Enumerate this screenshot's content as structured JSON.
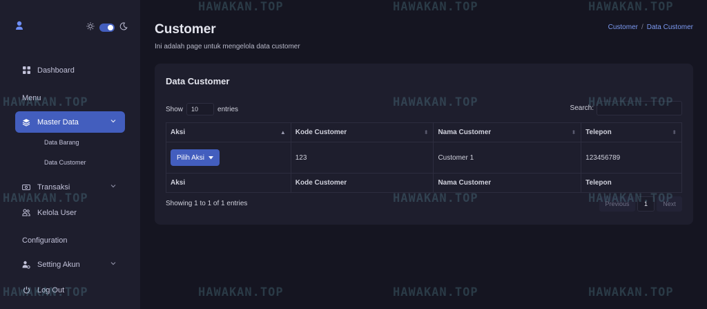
{
  "sidebar": {
    "items": [
      {
        "label": "Dashboard",
        "icon": "grid-icon"
      },
      {
        "label": "Master Data",
        "icon": "layers-icon",
        "active": true
      },
      {
        "label": "Transaksi",
        "icon": "cash-icon"
      },
      {
        "label": "Kelola User",
        "icon": "users-icon"
      },
      {
        "label": "Setting Akun",
        "icon": "user-gear-icon"
      },
      {
        "label": "Log Out",
        "icon": "power-icon"
      }
    ],
    "sections": {
      "menu": "Menu",
      "configuration": "Configuration"
    },
    "subitems": [
      "Data Barang",
      "Data Customer"
    ]
  },
  "page": {
    "title": "Customer",
    "subtitle": "Ini adalah page untuk mengelola data customer",
    "breadcrumb": [
      "Customer",
      "/",
      "Data Customer"
    ]
  },
  "card": {
    "title": "Data Customer",
    "show_label": "Show",
    "entries_value": "10",
    "entries_label": "entries",
    "search_label": "Search:",
    "columns": [
      "Aksi",
      "Kode Customer",
      "Nama Customer",
      "Telepon"
    ],
    "rows": [
      {
        "aksi": "Pilih Aksi",
        "kode": "123",
        "nama": "Customer 1",
        "telepon": "123456789"
      }
    ],
    "info": "Showing 1 to 1 of 1 entries",
    "pagination": {
      "previous": "Previous",
      "current": "1",
      "next": "Next"
    }
  },
  "watermark": "HAWAKAN.TOP",
  "colors": {
    "accent": "#435ebe",
    "sidebar": "#1e1e2d",
    "background": "#151521"
  }
}
